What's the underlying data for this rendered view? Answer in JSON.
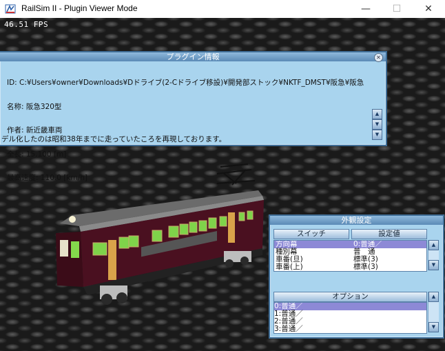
{
  "window": {
    "title": "RailSim II - Plugin Viewer Mode",
    "minimize": "—",
    "maximize": "☐",
    "close": "✕"
  },
  "viewport": {
    "fps": "46.51 FPS"
  },
  "plugin_info": {
    "title": "プラグイン情報",
    "lines": [
      "ID: C:¥Users¥owner¥Downloads¥Dドライブ(2-Cドライブ移設)¥開発部ストック¥NKTF_DMST¥阪急¥阪急",
      "名称: 阪急320型",
      "作者: 新近畿車両",
      "全長: 15.100 [m]",
      "最高速度: 110.0 [km/h]"
    ],
    "description": "デル化したのは昭和38年までに走っていたころを再現しております。"
  },
  "appearance": {
    "title": "外観設定",
    "switch_header": "スイッチ",
    "value_header": "設定値",
    "switch_rows": [
      {
        "name": "方向幕",
        "value": "0:普通／"
      },
      {
        "name": "種別幕",
        "value": "普　通"
      },
      {
        "name": "車番(旦)",
        "value": "標準(3)"
      },
      {
        "name": "車番(上)",
        "value": "標準(3)"
      }
    ],
    "options_header": "オプション",
    "option_rows": [
      "0:普通／",
      "1:普通／",
      "2:普通／",
      "3:普通／"
    ]
  }
}
